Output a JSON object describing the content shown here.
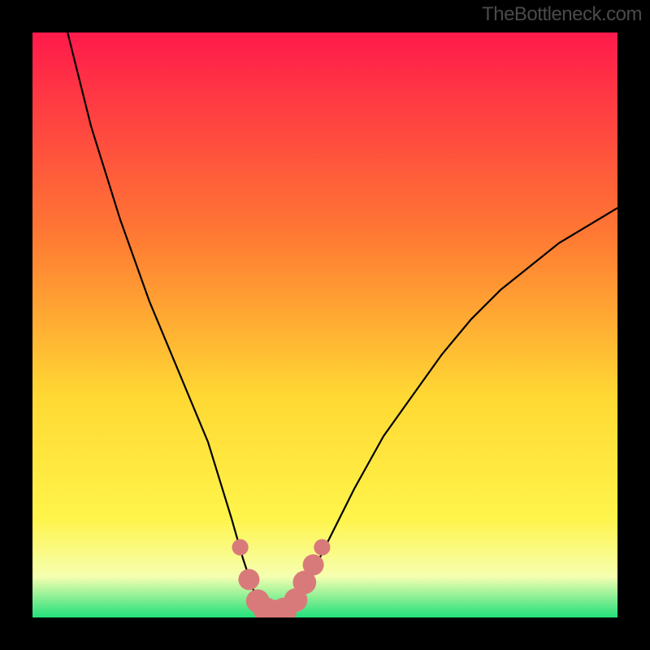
{
  "watermark": "TheBottleneck.com",
  "colors": {
    "frame": "#000000",
    "grad_top": "#ff1a4b",
    "grad_mid1": "#ff7a33",
    "grad_mid2": "#ffd833",
    "grad_low": "#fff44a",
    "grad_pale": "#f6ffb0",
    "grad_bottom": "#22e07a",
    "curve": "#000000",
    "markers": "#d97a7a"
  },
  "chart_data": {
    "type": "line",
    "title": "",
    "xlabel": "",
    "ylabel": "",
    "xlim": [
      0,
      100
    ],
    "ylim": [
      0,
      100
    ],
    "series": [
      {
        "name": "bottleneck-curve",
        "x": [
          6,
          10,
          15,
          20,
          25,
          30,
          34,
          36,
          38,
          40,
          42,
          44,
          46,
          50,
          55,
          60,
          65,
          70,
          75,
          80,
          85,
          90,
          95,
          100
        ],
        "values": [
          100,
          84,
          68,
          54,
          42,
          30,
          17,
          10,
          4,
          1,
          0.5,
          1,
          4,
          12,
          22,
          31,
          38,
          45,
          51,
          56,
          60,
          64,
          67,
          70
        ]
      }
    ],
    "markers": {
      "name": "highlight-points",
      "x": [
        35.5,
        37.0,
        38.5,
        40.0,
        41.5,
        43.0,
        45.0,
        46.5,
        48.0,
        49.5
      ],
      "values": [
        12.0,
        6.5,
        2.8,
        1.2,
        0.8,
        1.2,
        3.0,
        6.0,
        9.0,
        12.0
      ],
      "radius": [
        1.4,
        1.8,
        2.0,
        2.2,
        2.2,
        2.2,
        2.0,
        2.0,
        1.8,
        1.4
      ]
    }
  }
}
